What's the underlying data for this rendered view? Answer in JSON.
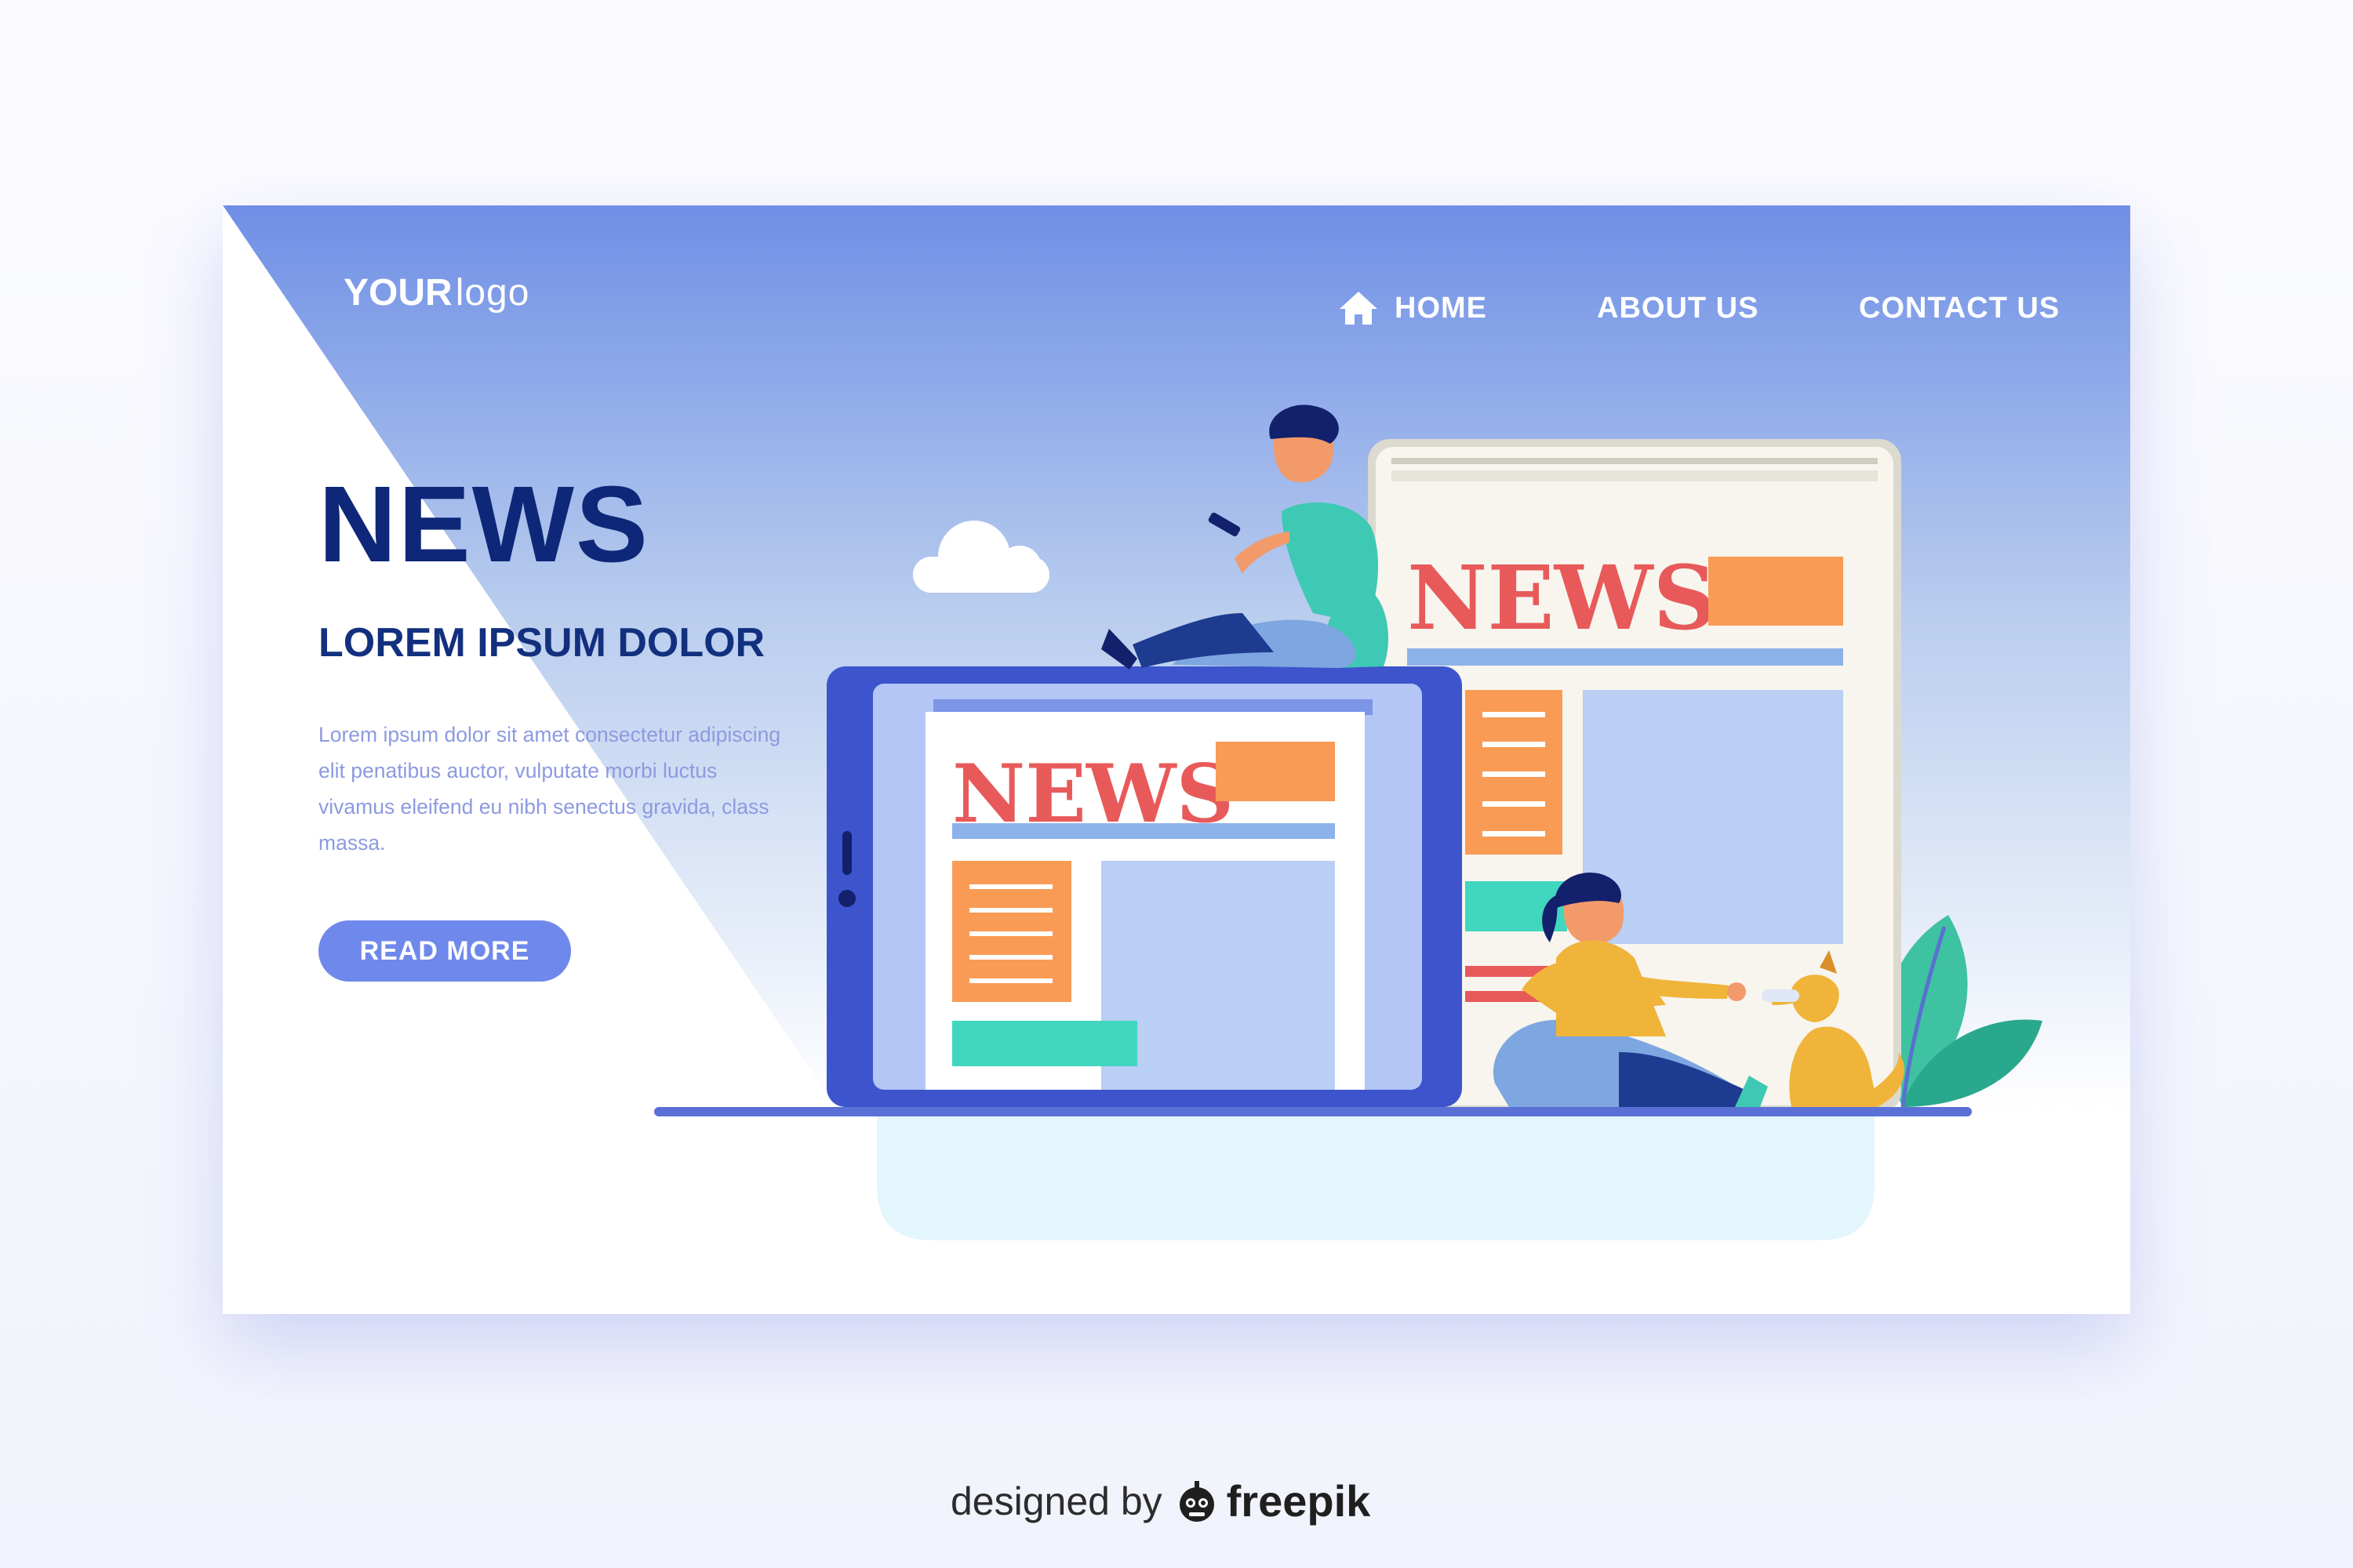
{
  "header": {
    "logo_bold": "YOUR",
    "logo_light": "logo",
    "nav": {
      "home": "HOME",
      "about": "ABOUT US",
      "contact": "CONTACT US"
    },
    "icons": {
      "home": "house-icon"
    }
  },
  "hero": {
    "title": "NEWS",
    "subtitle": "LOREM IPSUM DOLOR",
    "paragraph": "Lorem ipsum dolor sit amet consectetur adipiscing elit penatibus auctor, vulputate morbi luctus vivamus eleifend eu nibh senectus gravida, class massa.",
    "cta_label": "READ MORE"
  },
  "illustration": {
    "tablet_headline": "NEWS",
    "paper_headline": "NEWS"
  },
  "credit": {
    "prefix": "designed by",
    "brand": "freepik",
    "icon": "freepik-logo-icon"
  },
  "colors": {
    "gradient_top": "#6f8fe6",
    "navy": "#0e2778",
    "button": "#6f88ec",
    "paragraph": "#8d9ae0",
    "headline_red": "#e85a5a",
    "tablet_blue": "#3e54cc"
  }
}
